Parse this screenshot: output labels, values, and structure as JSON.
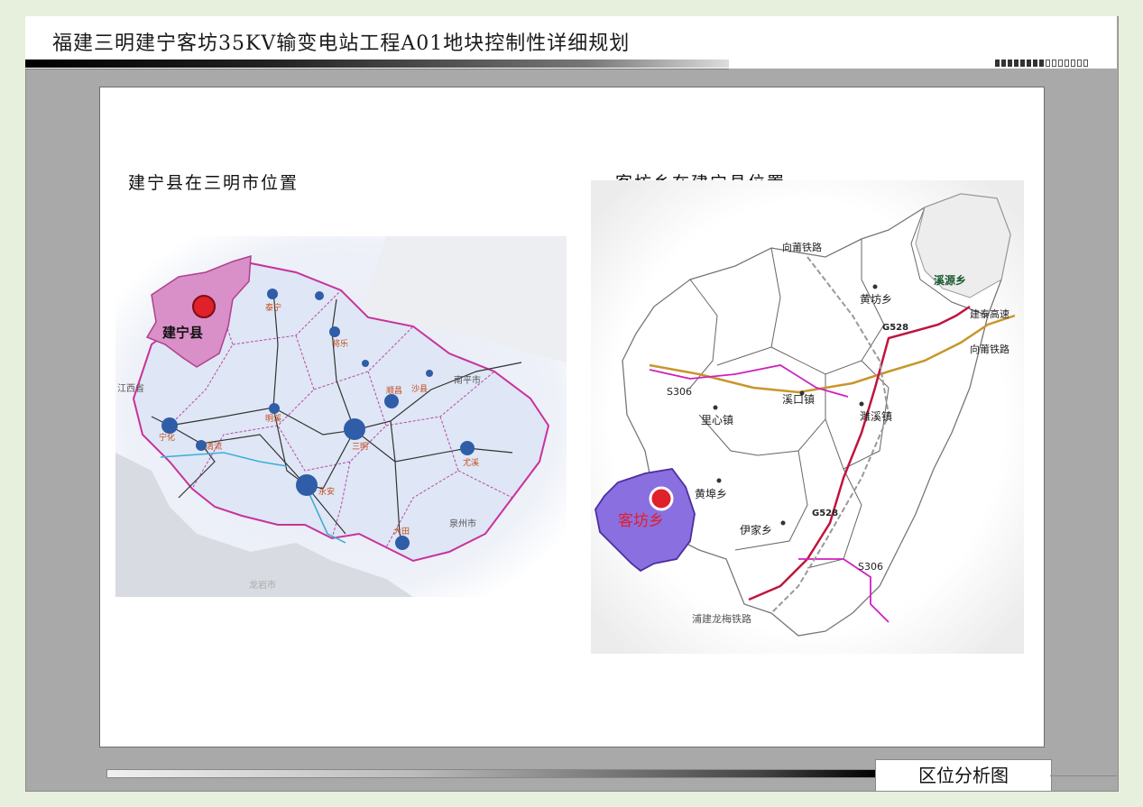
{
  "header": {
    "title": "福建三明建宁客坊35KV输变电站工程A01地块控制性详细规划"
  },
  "left_map": {
    "title": "建宁县在三明市位置",
    "highlight_label": "建宁县",
    "highlight_color": "#d98fc8",
    "cities": {
      "taining": "泰宁",
      "jiangle": "将乐",
      "shunchang": "顺昌",
      "ninghua": "宁化",
      "qingliu": "清流",
      "mingxi": "明溪",
      "sanming": "三明",
      "shaxian": "沙县",
      "youxi": "尤溪",
      "yongan": "永安",
      "datian": "大田"
    },
    "regions": {
      "jiangxi": "江西省",
      "nanping": "南平市",
      "quanzhou": "泉州市",
      "longyan": "龙岩市"
    }
  },
  "right_map": {
    "title": "客坊乡在建宁县位置",
    "highlight_label": "客坊乡",
    "highlight_color": "#8a6fe0",
    "townships": {
      "xiyuan": "溪源乡",
      "huangfang": "黄坊乡",
      "xikou": "溪口镇",
      "lixin": "里心镇",
      "junxi": "濉溪镇",
      "huangbu": "黄埠乡",
      "yijia": "伊家乡"
    },
    "roads": {
      "xiangpu_rail_top": "向莆铁路",
      "xiangpu_rail_right": "向莆铁路",
      "jiantai_expressway": "建泰高速",
      "g528_north": "G528",
      "g528_south": "G528",
      "s306_west": "S306",
      "s306_east": "S306",
      "pujian_rail": "浦建龙梅铁路"
    },
    "colors": {
      "g528": "#c0143c",
      "expressway": "#c8962a",
      "s306": "#d020c0"
    }
  },
  "footer": {
    "label": "区位分析图"
  }
}
